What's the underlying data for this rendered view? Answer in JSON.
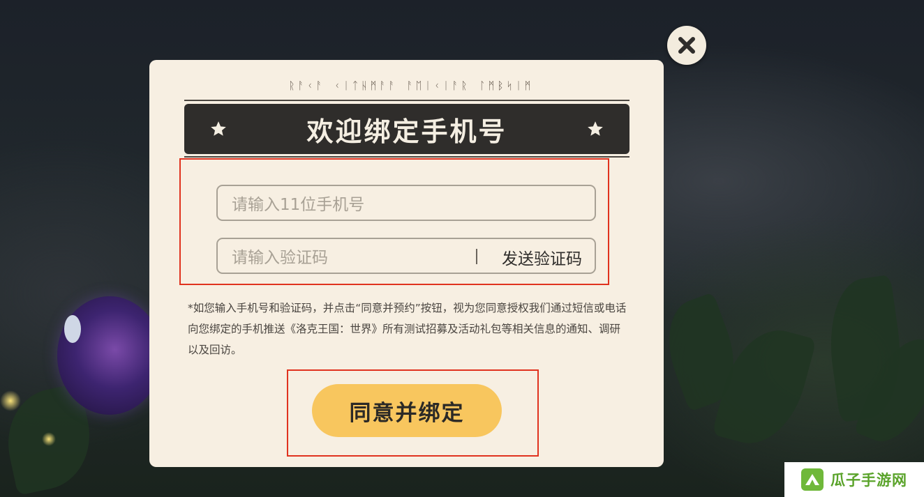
{
  "modal": {
    "rune_text": "ᚱᚨᚲᚨ ᚲᛁᛏᚺᛗᚨᚨ ᚨᛖᛁᚲᛁᚨᚱ ᛚᛗᛒᛋᛁᛗ",
    "title": "欢迎绑定手机号",
    "phone_placeholder": "请输入11位手机号",
    "code_placeholder": "请输入验证码",
    "send_code_label": "发送验证码",
    "notice": "*如您输入手机号和验证码，并点击“同意并预约”按钮，视为您同意授权我们通过短信或电话向您绑定的手机推送《洛克王国：世界》所有测试招募及活动礼包等相关信息的通知、调研以及回访。",
    "agree_button_label": "同意并绑定"
  },
  "icons": {
    "close": "close-icon",
    "title_stars": "star-icon",
    "watermark_logo": "leaf-logo-icon"
  },
  "watermark": {
    "text": "瓜子手游网"
  },
  "colors": {
    "modal_bg": "#f7efe2",
    "title_bar": "#2f2d2b",
    "agree_button": "#f8c65e",
    "highlight_box": "#e0321e",
    "watermark_green": "#5aa32a"
  }
}
